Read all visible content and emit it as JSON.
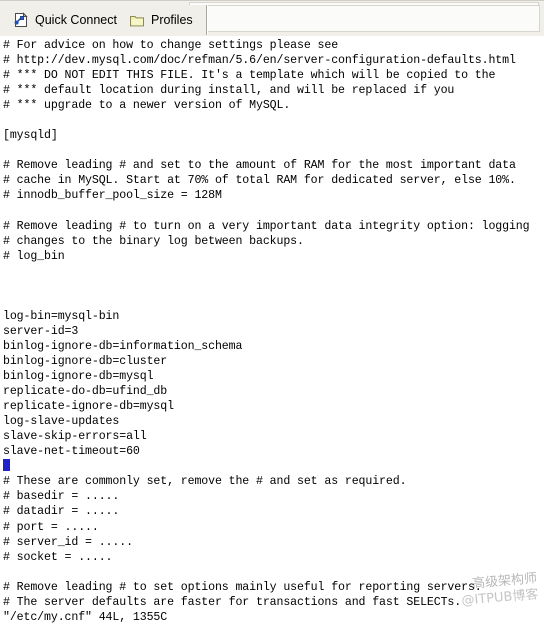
{
  "toolbar": {
    "buttons": [
      {
        "label": "Quick Connect",
        "icon": "quick-connect-icon"
      },
      {
        "label": "Profiles",
        "icon": "folder-icon"
      }
    ]
  },
  "terminal": {
    "lines": [
      "# For advice on how to change settings please see",
      "# http://dev.mysql.com/doc/refman/5.6/en/server-configuration-defaults.html",
      "# *** DO NOT EDIT THIS FILE. It's a template which will be copied to the",
      "# *** default location during install, and will be replaced if you",
      "# *** upgrade to a newer version of MySQL.",
      "",
      "[mysqld]",
      "",
      "# Remove leading # and set to the amount of RAM for the most important data",
      "# cache in MySQL. Start at 70% of total RAM for dedicated server, else 10%.",
      "# innodb_buffer_pool_size = 128M",
      "",
      "# Remove leading # to turn on a very important data integrity option: logging",
      "# changes to the binary log between backups.",
      "# log_bin",
      "",
      "",
      "",
      "log-bin=mysql-bin",
      "server-id=3",
      "binlog-ignore-db=information_schema",
      "binlog-ignore-db=cluster",
      "binlog-ignore-db=mysql",
      "replicate-do-db=ufind_db",
      "replicate-ignore-db=mysql",
      "log-slave-updates",
      "slave-skip-errors=all",
      "slave-net-timeout=60",
      "__CURSOR__",
      "# These are commonly set, remove the # and set as required.",
      "# basedir = .....",
      "# datadir = .....",
      "# port = .....",
      "# server_id = .....",
      "# socket = .....",
      "",
      "# Remove leading # to set options mainly useful for reporting servers.",
      "# The server defaults are faster for transactions and fast SELECTs.",
      "\"/etc/my.cnf\" 44L, 1355C"
    ],
    "status_line": "\"/etc/my.cnf\" 44L, 1355C",
    "cursor_color": "#2222cc"
  },
  "watermark": {
    "line1": "高级架构师",
    "line2": "@ITPUB博客"
  }
}
